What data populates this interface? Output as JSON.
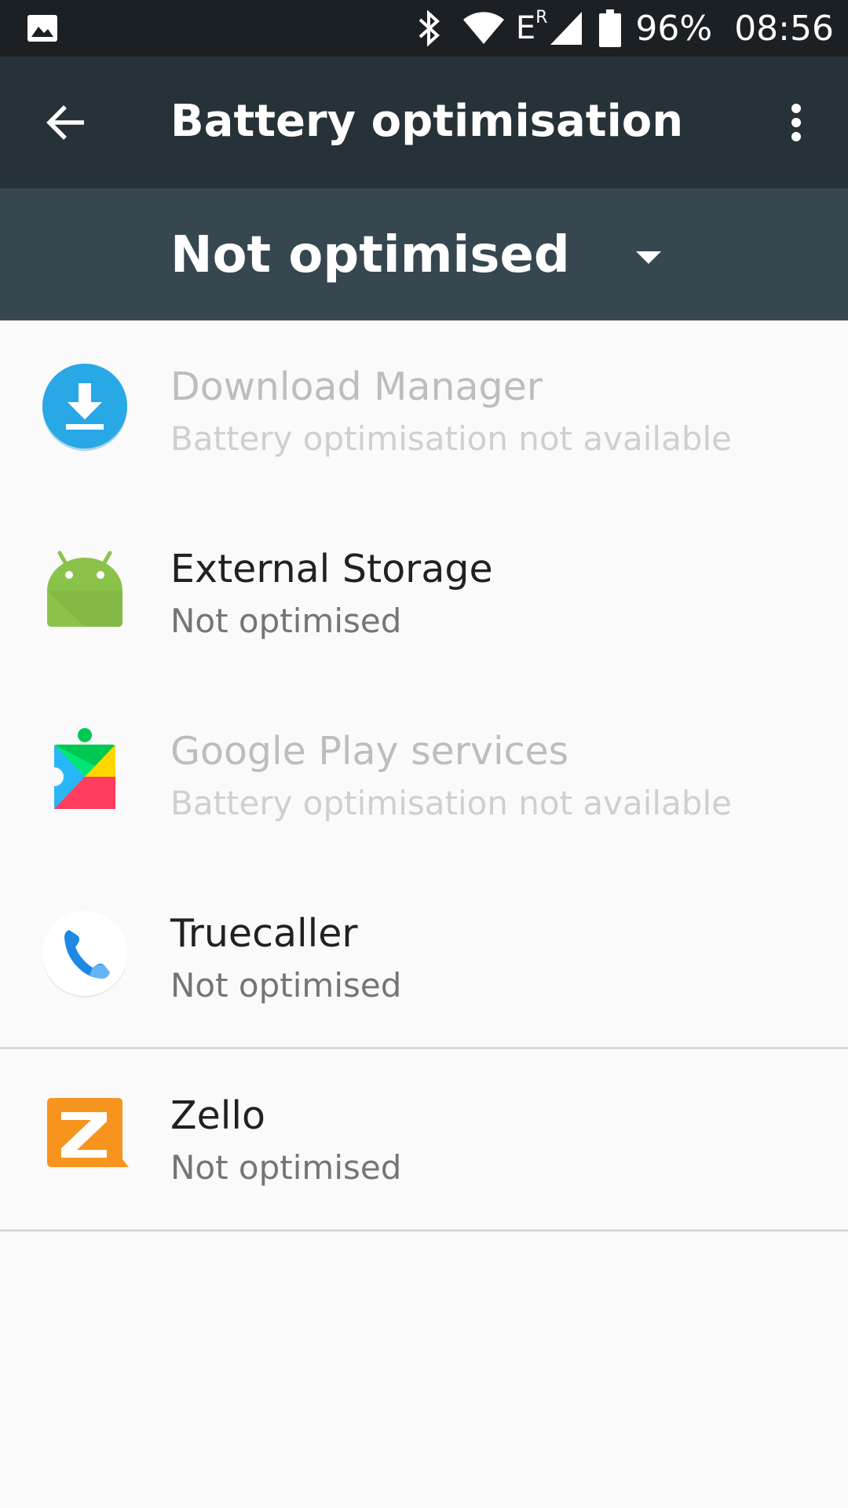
{
  "status_bar": {
    "battery": "96%",
    "time": "08:56",
    "network_type": "E",
    "roaming": "R",
    "icons": [
      "gallery-icon",
      "bluetooth-icon",
      "wifi-icon",
      "signal-icon",
      "battery-icon"
    ]
  },
  "toolbar": {
    "title": "Battery optimisation",
    "back_icon": "arrow-back-icon",
    "menu_icon": "more-vert-icon"
  },
  "filter": {
    "selected": "Not optimised"
  },
  "apps": [
    {
      "name": "Download Manager",
      "status": "Battery optimisation not available",
      "enabled": false,
      "icon": "download-manager-icon",
      "color": "#29a8e6"
    },
    {
      "name": "External Storage",
      "status": "Not optimised",
      "enabled": true,
      "icon": "android-icon",
      "color": "#8bc34a"
    },
    {
      "name": "Google Play services",
      "status": "Battery optimisation not available",
      "enabled": false,
      "icon": "play-services-icon",
      "color": "#00c853"
    },
    {
      "name": "Truecaller",
      "status": "Not optimised",
      "enabled": true,
      "icon": "phone-icon",
      "color": "#1e88e5"
    },
    {
      "name": "Zello",
      "status": "Not optimised",
      "enabled": true,
      "icon": "zello-icon",
      "color": "#f7941d"
    }
  ]
}
